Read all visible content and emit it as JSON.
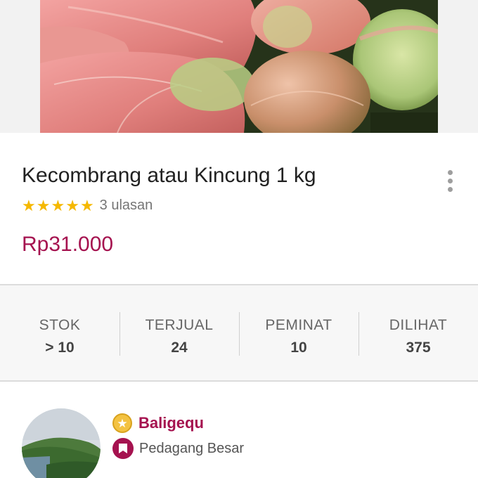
{
  "product": {
    "image_alt": "kecombrang-photo",
    "title": "Kecombrang atau Kincung 1 kg",
    "rating_stars": 5,
    "reviews": "3 ulasan",
    "price": "Rp31.000"
  },
  "stats": [
    {
      "label": "STOK",
      "value": "> 10"
    },
    {
      "label": "TERJUAL",
      "value": "24"
    },
    {
      "label": "PEMINAT",
      "value": "10"
    },
    {
      "label": "DILIHAT",
      "value": "375"
    }
  ],
  "seller": {
    "name": "Baligequ",
    "type": "Pedagang Besar"
  },
  "colors": {
    "accent": "#a5124f",
    "star": "#f5b800",
    "badge_gold": "#f3c241"
  },
  "icons": {
    "more": "more-vertical-icon",
    "star": "star-icon",
    "badge": "gold-badge-icon",
    "merchant": "merchant-bookmark-icon"
  }
}
